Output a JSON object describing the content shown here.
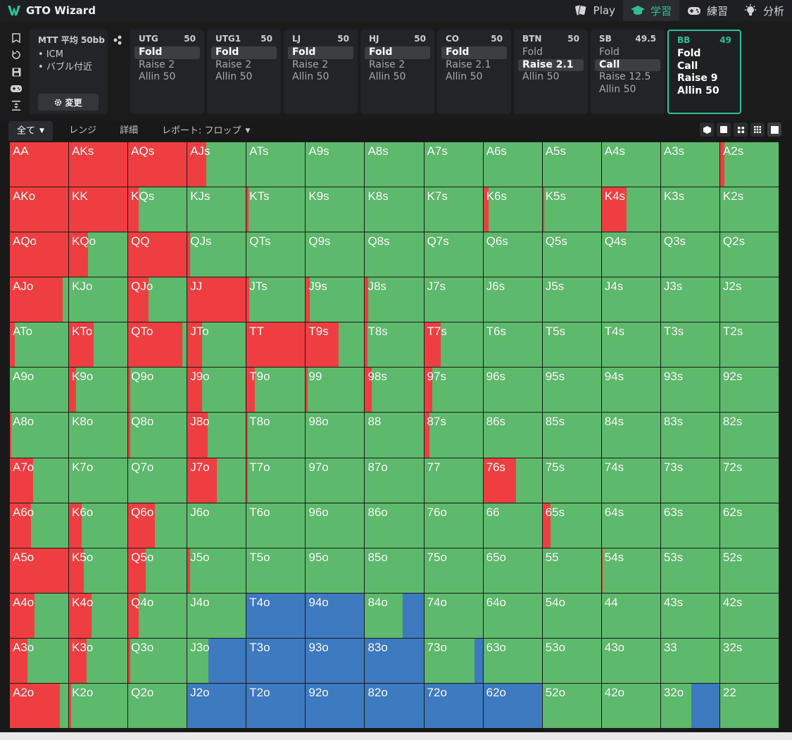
{
  "app": {
    "name": "GTO Wizard"
  },
  "nav": [
    {
      "label": "Play",
      "icon": "cards-icon",
      "active": false
    },
    {
      "label": "学習",
      "icon": "graduation-cap-icon",
      "active": true
    },
    {
      "label": "練習",
      "icon": "gamepad-icon",
      "active": false
    },
    {
      "label": "分析",
      "icon": "lightbulb-icon",
      "active": false
    }
  ],
  "colors": {
    "fold": "#5db96b",
    "raise": "#ef3e41",
    "allin": "#3d7ac0",
    "accent": "#2fbf98"
  },
  "mtt": {
    "title": "MTT  平均 50bb",
    "options": [
      "ICM",
      "バブル付近"
    ],
    "change_label": "変更"
  },
  "positions": [
    {
      "name": "UTG",
      "stack": "50",
      "actions": [
        "Fold",
        "Raise 2",
        "Allin 50"
      ],
      "selected": 0,
      "active": false
    },
    {
      "name": "UTG1",
      "stack": "50",
      "actions": [
        "Fold",
        "Raise 2",
        "Allin 50"
      ],
      "selected": 0,
      "active": false
    },
    {
      "name": "LJ",
      "stack": "50",
      "actions": [
        "Fold",
        "Raise 2",
        "Allin 50"
      ],
      "selected": 0,
      "active": false
    },
    {
      "name": "HJ",
      "stack": "50",
      "actions": [
        "Fold",
        "Raise 2",
        "Allin 50"
      ],
      "selected": 0,
      "active": false
    },
    {
      "name": "CO",
      "stack": "50",
      "actions": [
        "Fold",
        "Raise 2.1",
        "Allin 50"
      ],
      "selected": 0,
      "active": false
    },
    {
      "name": "BTN",
      "stack": "50",
      "actions": [
        "Fold",
        "Raise 2.1",
        "Allin 50"
      ],
      "selected": 1,
      "active": false
    },
    {
      "name": "SB",
      "stack": "49.5",
      "actions": [
        "Fold",
        "Call",
        "Raise 12.5",
        "Allin 50"
      ],
      "selected": 1,
      "active": false
    },
    {
      "name": "BB",
      "stack": "49",
      "actions": [
        "Fold",
        "Call",
        "Raise 9",
        "Allin 50"
      ],
      "selected": -1,
      "active": true
    }
  ],
  "tabs": [
    {
      "label": "全て",
      "dropdown": true,
      "active": true
    },
    {
      "label": "レンジ",
      "dropdown": false,
      "active": false
    },
    {
      "label": "詳細",
      "dropdown": false,
      "active": false
    },
    {
      "label": "レポート: フロップ",
      "dropdown": true,
      "active": false
    }
  ],
  "grid": {
    "rows": [
      [
        [
          "AA",
          [
            1,
            0
          ]
        ],
        [
          "AKs",
          [
            1,
            0
          ]
        ],
        [
          "AQs",
          [
            1,
            0
          ]
        ],
        [
          "AJs",
          [
            0.32,
            0
          ]
        ],
        [
          "ATs",
          [
            0,
            0
          ]
        ],
        [
          "A9s",
          [
            0,
            0
          ]
        ],
        [
          "A8s",
          [
            0,
            0
          ]
        ],
        [
          "A7s",
          [
            0,
            0
          ]
        ],
        [
          "A6s",
          [
            0,
            0
          ]
        ],
        [
          "A5s",
          [
            0,
            0
          ]
        ],
        [
          "A4s",
          [
            0,
            0
          ]
        ],
        [
          "A3s",
          [
            0,
            0
          ]
        ],
        [
          "A2s",
          [
            0.07,
            0
          ]
        ]
      ],
      [
        [
          "AKo",
          [
            1,
            0
          ]
        ],
        [
          "KK",
          [
            1,
            0
          ]
        ],
        [
          "KQs",
          [
            0.18,
            0
          ]
        ],
        [
          "KJs",
          [
            0,
            0
          ]
        ],
        [
          "KTs",
          [
            0.03,
            0
          ]
        ],
        [
          "K9s",
          [
            0,
            0
          ]
        ],
        [
          "K8s",
          [
            0,
            0
          ]
        ],
        [
          "K7s",
          [
            0,
            0
          ]
        ],
        [
          "K6s",
          [
            0.09,
            0
          ]
        ],
        [
          "K5s",
          [
            0.03,
            0
          ]
        ],
        [
          "K4s",
          [
            0.42,
            0
          ]
        ],
        [
          "K3s",
          [
            0,
            0
          ]
        ],
        [
          "K2s",
          [
            0,
            0
          ]
        ]
      ],
      [
        [
          "AQo",
          [
            1,
            0
          ]
        ],
        [
          "KQo",
          [
            0.33,
            0
          ]
        ],
        [
          "QQ",
          [
            1,
            0
          ]
        ],
        [
          "QJs",
          [
            0.05,
            0
          ]
        ],
        [
          "QTs",
          [
            0,
            0
          ]
        ],
        [
          "Q9s",
          [
            0,
            0
          ]
        ],
        [
          "Q8s",
          [
            0,
            0
          ]
        ],
        [
          "Q7s",
          [
            0,
            0
          ]
        ],
        [
          "Q6s",
          [
            0,
            0
          ]
        ],
        [
          "Q5s",
          [
            0,
            0
          ]
        ],
        [
          "Q4s",
          [
            0,
            0
          ]
        ],
        [
          "Q3s",
          [
            0,
            0
          ]
        ],
        [
          "Q2s",
          [
            0,
            0
          ]
        ]
      ],
      [
        [
          "AJo",
          [
            0.9,
            0
          ]
        ],
        [
          "KJo",
          [
            0,
            0
          ]
        ],
        [
          "QJo",
          [
            0.35,
            0
          ]
        ],
        [
          "JJ",
          [
            1,
            0
          ]
        ],
        [
          "JTs",
          [
            0.05,
            0
          ]
        ],
        [
          "J9s",
          [
            0.07,
            0
          ]
        ],
        [
          "J8s",
          [
            0.05,
            0
          ]
        ],
        [
          "J7s",
          [
            0,
            0
          ]
        ],
        [
          "J6s",
          [
            0,
            0
          ]
        ],
        [
          "J5s",
          [
            0,
            0
          ]
        ],
        [
          "J4s",
          [
            0,
            0
          ]
        ],
        [
          "J3s",
          [
            0,
            0
          ]
        ],
        [
          "J2s",
          [
            0,
            0
          ]
        ]
      ],
      [
        [
          "ATo",
          [
            0.08,
            0
          ]
        ],
        [
          "KTo",
          [
            0.42,
            0
          ]
        ],
        [
          "QTo",
          [
            0.93,
            0
          ]
        ],
        [
          "JTo",
          [
            0.25,
            0
          ]
        ],
        [
          "TT",
          [
            1,
            0
          ]
        ],
        [
          "T9s",
          [
            0.56,
            0
          ]
        ],
        [
          "T8s",
          [
            0.04,
            0
          ]
        ],
        [
          "T7s",
          [
            0.28,
            0
          ]
        ],
        [
          "T6s",
          [
            0,
            0
          ]
        ],
        [
          "T5s",
          [
            0,
            0
          ]
        ],
        [
          "T4s",
          [
            0,
            0
          ]
        ],
        [
          "T3s",
          [
            0,
            0
          ]
        ],
        [
          "T2s",
          [
            0,
            0
          ]
        ]
      ],
      [
        [
          "A9o",
          [
            0,
            0
          ]
        ],
        [
          "K9o",
          [
            0.12,
            0
          ]
        ],
        [
          "Q9o",
          [
            0.04,
            0
          ]
        ],
        [
          "J9o",
          [
            0.25,
            0
          ]
        ],
        [
          "T9o",
          [
            0.14,
            0
          ]
        ],
        [
          "99",
          [
            0.03,
            0
          ]
        ],
        [
          "98s",
          [
            0.12,
            0
          ]
        ],
        [
          "97s",
          [
            0.14,
            0
          ]
        ],
        [
          "96s",
          [
            0,
            0
          ]
        ],
        [
          "95s",
          [
            0,
            0
          ]
        ],
        [
          "94s",
          [
            0,
            0
          ]
        ],
        [
          "93s",
          [
            0,
            0
          ]
        ],
        [
          "92s",
          [
            0,
            0
          ]
        ]
      ],
      [
        [
          "A8o",
          [
            0.02,
            0
          ]
        ],
        [
          "K8o",
          [
            0,
            0
          ]
        ],
        [
          "Q8o",
          [
            0.03,
            0
          ]
        ],
        [
          "J8o",
          [
            0.35,
            0
          ]
        ],
        [
          "T8o",
          [
            0.02,
            0
          ]
        ],
        [
          "98o",
          [
            0,
            0
          ]
        ],
        [
          "88",
          [
            0,
            0
          ]
        ],
        [
          "87s",
          [
            0.09,
            0
          ]
        ],
        [
          "86s",
          [
            0,
            0
          ]
        ],
        [
          "85s",
          [
            0,
            0
          ]
        ],
        [
          "84s",
          [
            0,
            0
          ]
        ],
        [
          "83s",
          [
            0,
            0
          ]
        ],
        [
          "82s",
          [
            0,
            0
          ]
        ]
      ],
      [
        [
          "A7o",
          [
            0.4,
            0
          ]
        ],
        [
          "K7o",
          [
            0,
            0
          ]
        ],
        [
          "Q7o",
          [
            0,
            0
          ]
        ],
        [
          "J7o",
          [
            0.5,
            0
          ]
        ],
        [
          "T7o",
          [
            0.02,
            0
          ]
        ],
        [
          "97o",
          [
            0,
            0
          ]
        ],
        [
          "87o",
          [
            0,
            0
          ]
        ],
        [
          "77",
          [
            0,
            0
          ]
        ],
        [
          "76s",
          [
            0.56,
            0
          ]
        ],
        [
          "75s",
          [
            0,
            0
          ]
        ],
        [
          "74s",
          [
            0,
            0
          ]
        ],
        [
          "73s",
          [
            0,
            0
          ]
        ],
        [
          "72s",
          [
            0,
            0
          ]
        ]
      ],
      [
        [
          "A6o",
          [
            0.36,
            0
          ]
        ],
        [
          "K6o",
          [
            0.22,
            0
          ]
        ],
        [
          "Q6o",
          [
            0.45,
            0
          ]
        ],
        [
          "J6o",
          [
            0,
            0
          ]
        ],
        [
          "T6o",
          [
            0,
            0
          ]
        ],
        [
          "96o",
          [
            0,
            0
          ]
        ],
        [
          "86o",
          [
            0,
            0
          ]
        ],
        [
          "76o",
          [
            0,
            0
          ]
        ],
        [
          "66",
          [
            0,
            0
          ]
        ],
        [
          "65s",
          [
            0.14,
            0
          ]
        ],
        [
          "64s",
          [
            0,
            0
          ]
        ],
        [
          "63s",
          [
            0,
            0
          ]
        ],
        [
          "62s",
          [
            0,
            0
          ]
        ]
      ],
      [
        [
          "A5o",
          [
            1,
            0
          ]
        ],
        [
          "K5o",
          [
            0.25,
            0
          ]
        ],
        [
          "Q5o",
          [
            0.3,
            0
          ]
        ],
        [
          "J5o",
          [
            0.04,
            0
          ]
        ],
        [
          "T5o",
          [
            0,
            0
          ]
        ],
        [
          "95o",
          [
            0,
            0
          ]
        ],
        [
          "85o",
          [
            0,
            0
          ]
        ],
        [
          "75o",
          [
            0,
            0
          ]
        ],
        [
          "65o",
          [
            0,
            0
          ]
        ],
        [
          "55",
          [
            0,
            0
          ]
        ],
        [
          "54s",
          [
            0.02,
            0
          ]
        ],
        [
          "53s",
          [
            0,
            0
          ]
        ],
        [
          "52s",
          [
            0,
            0
          ]
        ]
      ],
      [
        [
          "A4o",
          [
            0.42,
            0
          ]
        ],
        [
          "K4o",
          [
            0.39,
            0
          ]
        ],
        [
          "Q4o",
          [
            0.18,
            0
          ]
        ],
        [
          "J4o",
          [
            0,
            0
          ]
        ],
        [
          "T4o",
          [
            0,
            1
          ]
        ],
        [
          "94o",
          [
            0,
            1
          ]
        ],
        [
          "84o",
          [
            0,
            0.36
          ]
        ],
        [
          "74o",
          [
            0,
            0
          ]
        ],
        [
          "64o",
          [
            0,
            0
          ]
        ],
        [
          "54o",
          [
            0,
            0
          ]
        ],
        [
          "44",
          [
            0,
            0
          ]
        ],
        [
          "43s",
          [
            0,
            0
          ]
        ],
        [
          "42s",
          [
            0,
            0
          ]
        ]
      ],
      [
        [
          "A3o",
          [
            0.3,
            0
          ]
        ],
        [
          "K3o",
          [
            0.3,
            0
          ]
        ],
        [
          "Q3o",
          [
            0.03,
            0
          ]
        ],
        [
          "J3o",
          [
            0,
            0.64
          ]
        ],
        [
          "T3o",
          [
            0,
            1
          ]
        ],
        [
          "93o",
          [
            0,
            1
          ]
        ],
        [
          "83o",
          [
            0,
            1
          ]
        ],
        [
          "73o",
          [
            0,
            0.14
          ]
        ],
        [
          "63o",
          [
            0,
            0
          ]
        ],
        [
          "53o",
          [
            0,
            0
          ]
        ],
        [
          "43o",
          [
            0,
            0
          ]
        ],
        [
          "33",
          [
            0,
            0
          ]
        ],
        [
          "32s",
          [
            0,
            0
          ]
        ]
      ],
      [
        [
          "A2o",
          [
            0.85,
            0
          ]
        ],
        [
          "K2o",
          [
            0.03,
            0
          ]
        ],
        [
          "Q2o",
          [
            0,
            0
          ]
        ],
        [
          "J2o",
          [
            0,
            1
          ]
        ],
        [
          "T2o",
          [
            0,
            1
          ]
        ],
        [
          "92o",
          [
            0,
            1
          ]
        ],
        [
          "82o",
          [
            0,
            1
          ]
        ],
        [
          "72o",
          [
            0,
            1
          ]
        ],
        [
          "62o",
          [
            0,
            1
          ]
        ],
        [
          "52o",
          [
            0,
            0
          ]
        ],
        [
          "42o",
          [
            0,
            0
          ]
        ],
        [
          "32o",
          [
            0,
            0.48
          ]
        ],
        [
          "22",
          [
            0,
            0
          ]
        ]
      ]
    ]
  }
}
